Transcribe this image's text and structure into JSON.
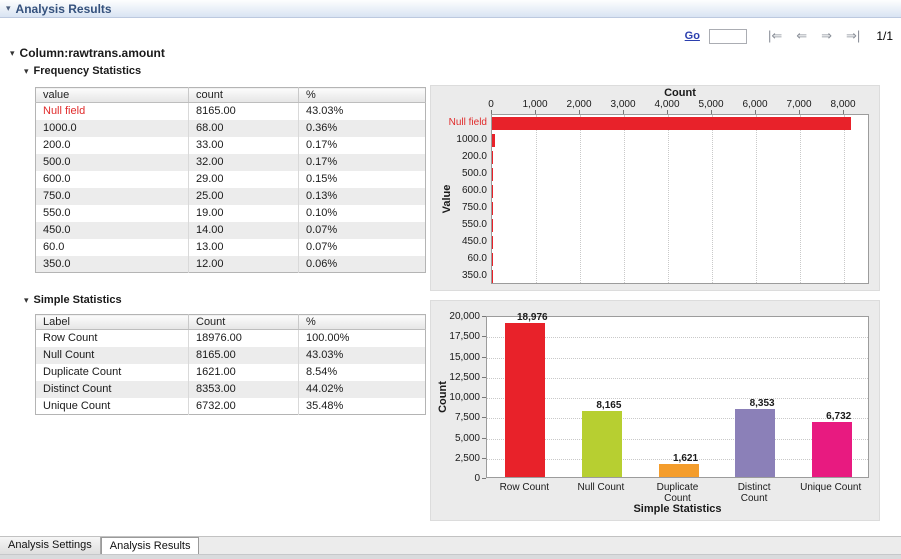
{
  "header": {
    "title": "Analysis Results"
  },
  "pager": {
    "go": "Go",
    "input_value": "",
    "page": "1/1"
  },
  "icons": {
    "collapse": "▾",
    "first": "|⇐",
    "prev": "⇐",
    "next": "⇒",
    "last": "⇒|"
  },
  "column_section": {
    "title": "Column:rawtrans.amount"
  },
  "frequency": {
    "title": "Frequency Statistics",
    "headers": [
      "value",
      "count",
      "%"
    ],
    "rows": [
      [
        "Null field",
        "8165.00",
        "43.03%"
      ],
      [
        "1000.0",
        "68.00",
        "0.36%"
      ],
      [
        "200.0",
        "33.00",
        "0.17%"
      ],
      [
        "500.0",
        "32.00",
        "0.17%"
      ],
      [
        "600.0",
        "29.00",
        "0.15%"
      ],
      [
        "750.0",
        "25.00",
        "0.13%"
      ],
      [
        "550.0",
        "19.00",
        "0.10%"
      ],
      [
        "450.0",
        "14.00",
        "0.07%"
      ],
      [
        "60.0",
        "13.00",
        "0.07%"
      ],
      [
        "350.0",
        "12.00",
        "0.06%"
      ]
    ]
  },
  "simple": {
    "title": "Simple Statistics",
    "headers": [
      "Label",
      "Count",
      "%"
    ],
    "rows": [
      [
        "Row Count",
        "18976.00",
        "100.00%"
      ],
      [
        "Null Count",
        "8165.00",
        "43.03%"
      ],
      [
        "Duplicate Count",
        "1621.00",
        "8.54%"
      ],
      [
        "Distinct Count",
        "8353.00",
        "44.02%"
      ],
      [
        "Unique Count",
        "6732.00",
        "35.48%"
      ]
    ]
  },
  "tabs": [
    {
      "label": "Analysis Settings",
      "active": false
    },
    {
      "label": "Analysis Results",
      "active": true
    }
  ],
  "chart_data": [
    {
      "type": "bar",
      "orientation": "horizontal",
      "title": "Count",
      "category_axis_label": "Value",
      "categories": [
        "Null field",
        "1000.0",
        "200.0",
        "500.0",
        "600.0",
        "750.0",
        "550.0",
        "450.0",
        "60.0",
        "350.0"
      ],
      "values": [
        8165,
        68,
        33,
        32,
        29,
        25,
        19,
        14,
        13,
        12
      ],
      "xlim": [
        0,
        8590
      ],
      "xticks": [
        0,
        1000,
        2000,
        3000,
        4000,
        5000,
        6000,
        7000,
        8000
      ],
      "bar_color": "#e8222a",
      "null_category_color": "#e02b2b",
      "grid": true,
      "legend": "none"
    },
    {
      "type": "bar",
      "orientation": "vertical",
      "xlabel": "Simple Statistics",
      "ylabel": "Count",
      "categories": [
        "Row Count",
        "Null Count",
        "Duplicate Count",
        "Distinct Count",
        "Unique Count"
      ],
      "category_display_lines": [
        [
          "Row Count"
        ],
        [
          "Null Count"
        ],
        [
          "Duplicate",
          "Count"
        ],
        [
          "Distinct",
          "Count"
        ],
        [
          "Unique Count"
        ]
      ],
      "values": [
        18976,
        8165,
        1621,
        8353,
        6732
      ],
      "value_labels": [
        "18,976",
        "8,165",
        "1,621",
        "8,353",
        "6,732"
      ],
      "bar_colors": [
        "#e8222a",
        "#b7cf31",
        "#f49d2c",
        "#8b80b8",
        "#e81a80"
      ],
      "ylim": [
        0,
        20000
      ],
      "yticks": [
        0,
        2500,
        5000,
        7500,
        10000,
        12500,
        15000,
        17500,
        20000
      ],
      "grid": true,
      "legend": "none"
    }
  ],
  "colors": {
    "header_text": "#34517d",
    "null_red": "#e02b2b",
    "panel_bg": "#ebebeb",
    "link_blue": "#2b3fae"
  }
}
